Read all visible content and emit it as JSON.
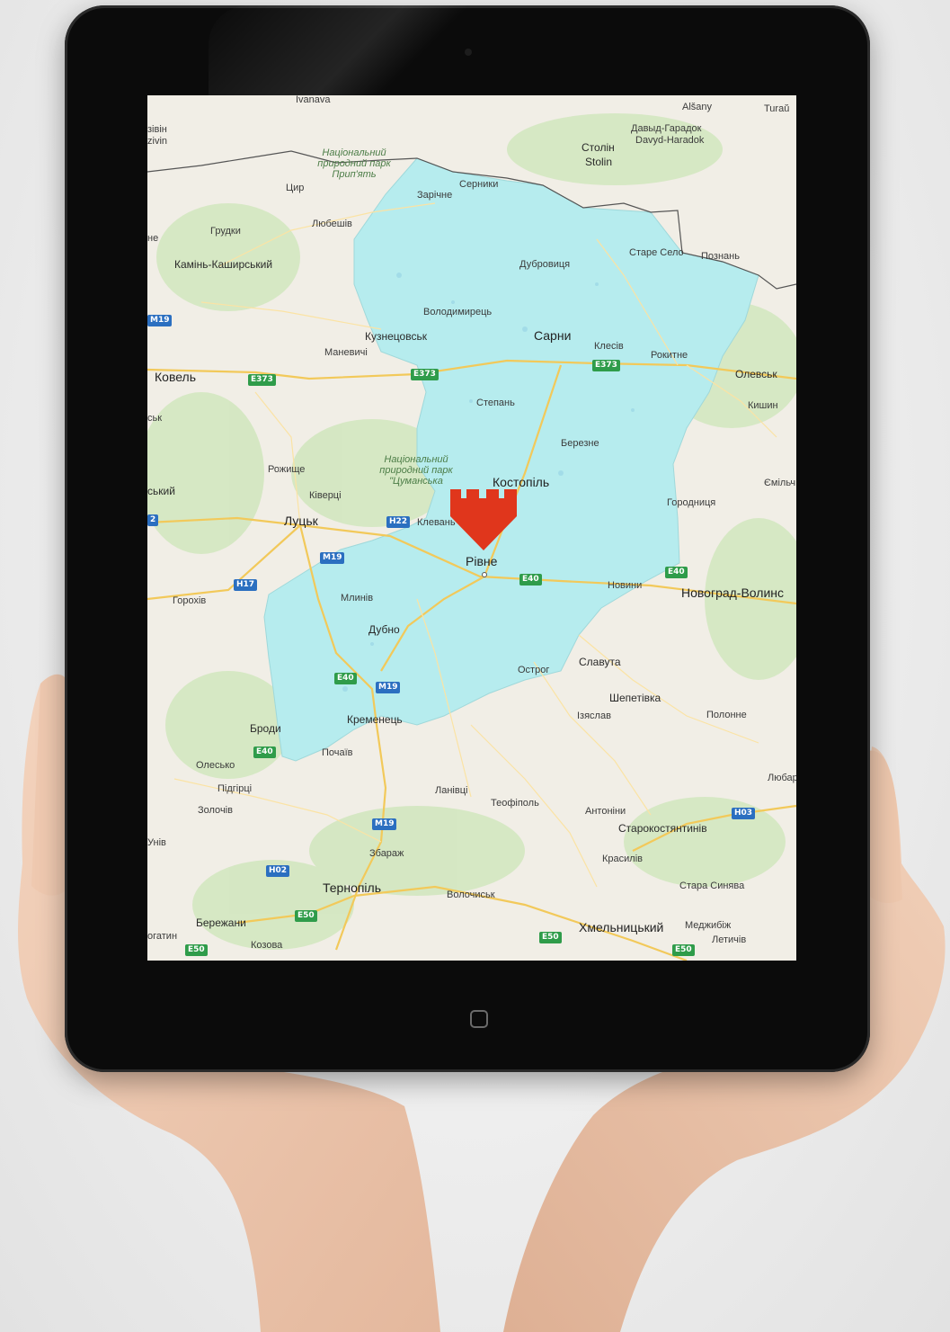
{
  "map": {
    "region_fill": "#b6ecee",
    "marker_color": "#e0361c",
    "center_city": "Рівне",
    "cities_major": [
      {
        "id": "kovel",
        "name": "Ковель"
      },
      {
        "id": "lutsk",
        "name": "Луцьк"
      },
      {
        "id": "novohrad",
        "name": "Новоград-Волинс"
      },
      {
        "id": "kostopil",
        "name": "Костопіль"
      },
      {
        "id": "sarny",
        "name": "Сарни"
      },
      {
        "id": "kuznetsovsk",
        "name": "Кузнецовськ"
      },
      {
        "id": "dubno",
        "name": "Дубно"
      },
      {
        "id": "kremenets",
        "name": "Кременець"
      },
      {
        "id": "slavuta",
        "name": "Славута"
      },
      {
        "id": "shepetivka",
        "name": "Шепетівка"
      },
      {
        "id": "ternopil",
        "name": "Тернопіль"
      },
      {
        "id": "khmelnytskyi",
        "name": "Хмельницький"
      },
      {
        "id": "starokostiantyniv",
        "name": "Старокостянтинів"
      },
      {
        "id": "berezhany",
        "name": "Бережани"
      },
      {
        "id": "kamin",
        "name": "Камінь-Каширський"
      },
      {
        "id": "brody",
        "name": "Броди"
      },
      {
        "id": "olevsk",
        "name": "Олевськ"
      }
    ],
    "cities_minor": [
      {
        "id": "ivanava",
        "name": "Ivanava"
      },
      {
        "id": "alsany",
        "name": "Alšany"
      },
      {
        "id": "turau",
        "name": "Turaŭ"
      },
      {
        "id": "davyd1",
        "name": "Давыд-Гарадок"
      },
      {
        "id": "davyd2",
        "name": "Davyd-Haradok"
      },
      {
        "id": "stolin1",
        "name": "Столін"
      },
      {
        "id": "stolin2",
        "name": "Stolin"
      },
      {
        "id": "zibiv",
        "name": "зівін"
      },
      {
        "id": "zivin",
        "name": "zivin"
      },
      {
        "id": "tsyr",
        "name": "Цир"
      },
      {
        "id": "liubeshiv",
        "name": "Любешів"
      },
      {
        "id": "zarichne",
        "name": "Зарічне"
      },
      {
        "id": "serniky",
        "name": "Серники"
      },
      {
        "id": "hrudky",
        "name": "Грудки"
      },
      {
        "id": "dubrovytsia",
        "name": "Дубровиця"
      },
      {
        "id": "stare",
        "name": "Старе Село"
      },
      {
        "id": "poznan",
        "name": "Познань"
      },
      {
        "id": "volodymyrets",
        "name": "Володимирець"
      },
      {
        "id": "manevychi",
        "name": "Маневичі"
      },
      {
        "id": "klesiv",
        "name": "Клесів"
      },
      {
        "id": "rokytne",
        "name": "Рокитне"
      },
      {
        "id": "stepan",
        "name": "Степань"
      },
      {
        "id": "kyshyn",
        "name": "Кишин"
      },
      {
        "id": "berezne",
        "name": "Березне"
      },
      {
        "id": "rozhyshche",
        "name": "Рожище"
      },
      {
        "id": "kivertsi",
        "name": "Ківерці"
      },
      {
        "id": "klevan",
        "name": "Клевань"
      },
      {
        "id": "horodnytsia",
        "name": "Городниця"
      },
      {
        "id": "emil",
        "name": "Ємільч"
      },
      {
        "id": "horokhiv",
        "name": "Горохів"
      },
      {
        "id": "mlyniv",
        "name": "Млинів"
      },
      {
        "id": "novyny",
        "name": "Новини"
      },
      {
        "id": "ostroh",
        "name": "Острог"
      },
      {
        "id": "iziaslav",
        "name": "Ізяслав"
      },
      {
        "id": "polonne",
        "name": "Полонне"
      },
      {
        "id": "pochaiv",
        "name": "Почаїв"
      },
      {
        "id": "olesko",
        "name": "Олесько"
      },
      {
        "id": "pidhirtsi",
        "name": "Підгірці"
      },
      {
        "id": "zolochiv",
        "name": "Золочів"
      },
      {
        "id": "lanivtsi",
        "name": "Ланівці"
      },
      {
        "id": "teofipol",
        "name": "Теофіполь"
      },
      {
        "id": "antoniny",
        "name": "Антоніни"
      },
      {
        "id": "liubar",
        "name": "Любар"
      },
      {
        "id": "zbarazh",
        "name": "Збараж"
      },
      {
        "id": "krasyliv",
        "name": "Красилів"
      },
      {
        "id": "stara",
        "name": "Стара Синява"
      },
      {
        "id": "volochysk",
        "name": "Волочиськ"
      },
      {
        "id": "medzhybizh",
        "name": "Меджибіж"
      },
      {
        "id": "letychiv",
        "name": "Летичів"
      },
      {
        "id": "kozova",
        "name": "Козова"
      },
      {
        "id": "rohatyn",
        "name": "огатин"
      },
      {
        "id": "yniv",
        "name": "Унів"
      },
      {
        "id": "sk",
        "name": "ськ"
      },
      {
        "id": "skyi",
        "name": "ський"
      },
      {
        "id": "ne",
        "name": "не"
      }
    ],
    "parks": [
      {
        "id": "park1",
        "name": "Національний природний парк Прип'ять"
      },
      {
        "id": "park2",
        "name": "Національний природний парк \"Цуманська"
      }
    ],
    "roads": [
      {
        "id": "r_m19_a",
        "label": "M19",
        "kind": "m"
      },
      {
        "id": "r_e373_a",
        "label": "E373",
        "kind": "e"
      },
      {
        "id": "r_e373_b",
        "label": "E373",
        "kind": "e"
      },
      {
        "id": "r_e373_c",
        "label": "E373",
        "kind": "e"
      },
      {
        "id": "r_h22",
        "label": "H22",
        "kind": "m"
      },
      {
        "id": "r_m19_b",
        "label": "M19",
        "kind": "m"
      },
      {
        "id": "r_h17",
        "label": "H17",
        "kind": "m"
      },
      {
        "id": "r_e40_a",
        "label": "E40",
        "kind": "e"
      },
      {
        "id": "r_e40_b",
        "label": "E40",
        "kind": "e"
      },
      {
        "id": "r_e40_c",
        "label": "E40",
        "kind": "e"
      },
      {
        "id": "r_m19_c",
        "label": "M19",
        "kind": "m"
      },
      {
        "id": "r_e40_d",
        "label": "E40",
        "kind": "e"
      },
      {
        "id": "r_m19_d",
        "label": "M19",
        "kind": "m"
      },
      {
        "id": "r_h02",
        "label": "H02",
        "kind": "m"
      },
      {
        "id": "r_h03",
        "label": "H03",
        "kind": "m"
      },
      {
        "id": "r_e50_a",
        "label": "E50",
        "kind": "e"
      },
      {
        "id": "r_e50_b",
        "label": "E50",
        "kind": "e"
      },
      {
        "id": "r_e50_c",
        "label": "E50",
        "kind": "e"
      },
      {
        "id": "r_e50_d",
        "label": "E50",
        "kind": "e"
      },
      {
        "id": "r_m2",
        "label": "2",
        "kind": "m"
      }
    ]
  }
}
